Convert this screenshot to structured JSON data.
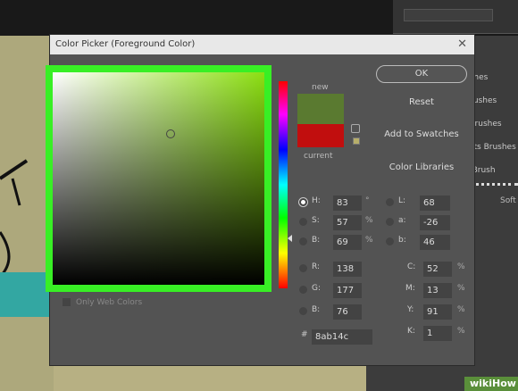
{
  "dialog": {
    "title": "Color Picker (Foreground Color)",
    "close_icon": "close-icon"
  },
  "preview": {
    "new_label": "new",
    "current_label": "current",
    "new_color": "#5a7a30",
    "current_color": "#c10e0e"
  },
  "buttons": {
    "ok": "OK",
    "reset": "Reset",
    "add_to_swatches": "Add to Swatches",
    "color_libraries": "Color Libraries"
  },
  "web_colors_label": "Only Web Colors",
  "hsb": {
    "h": {
      "label": "H:",
      "value": "83",
      "unit": "°"
    },
    "s": {
      "label": "S:",
      "value": "57",
      "unit": "%"
    },
    "b": {
      "label": "B:",
      "value": "69",
      "unit": "%"
    }
  },
  "rgb": {
    "r": {
      "label": "R:",
      "value": "138"
    },
    "g": {
      "label": "G:",
      "value": "177"
    },
    "b": {
      "label": "B:",
      "value": "76"
    }
  },
  "lab": {
    "l": {
      "label": "L:",
      "value": "68"
    },
    "a": {
      "label": "a:",
      "value": "-26"
    },
    "b": {
      "label": "b:",
      "value": "46"
    }
  },
  "cmyk": {
    "c": {
      "label": "C:",
      "value": "52",
      "unit": "%"
    },
    "m": {
      "label": "M:",
      "value": "13",
      "unit": "%"
    },
    "y": {
      "label": "Y:",
      "value": "91",
      "unit": "%"
    },
    "k": {
      "label": "K:",
      "value": "1",
      "unit": "%"
    }
  },
  "hex": {
    "label": "#",
    "value": "8ab14c"
  },
  "background_panel": {
    "items": [
      "ushes",
      "Brushes",
      "l Brushes",
      "ects Brushes",
      "d Brush"
    ],
    "soft_label": "Soft"
  },
  "watermark": "wikiHow",
  "colors": {
    "highlight": "#38ef25",
    "field_hue": "#8cdf12"
  }
}
